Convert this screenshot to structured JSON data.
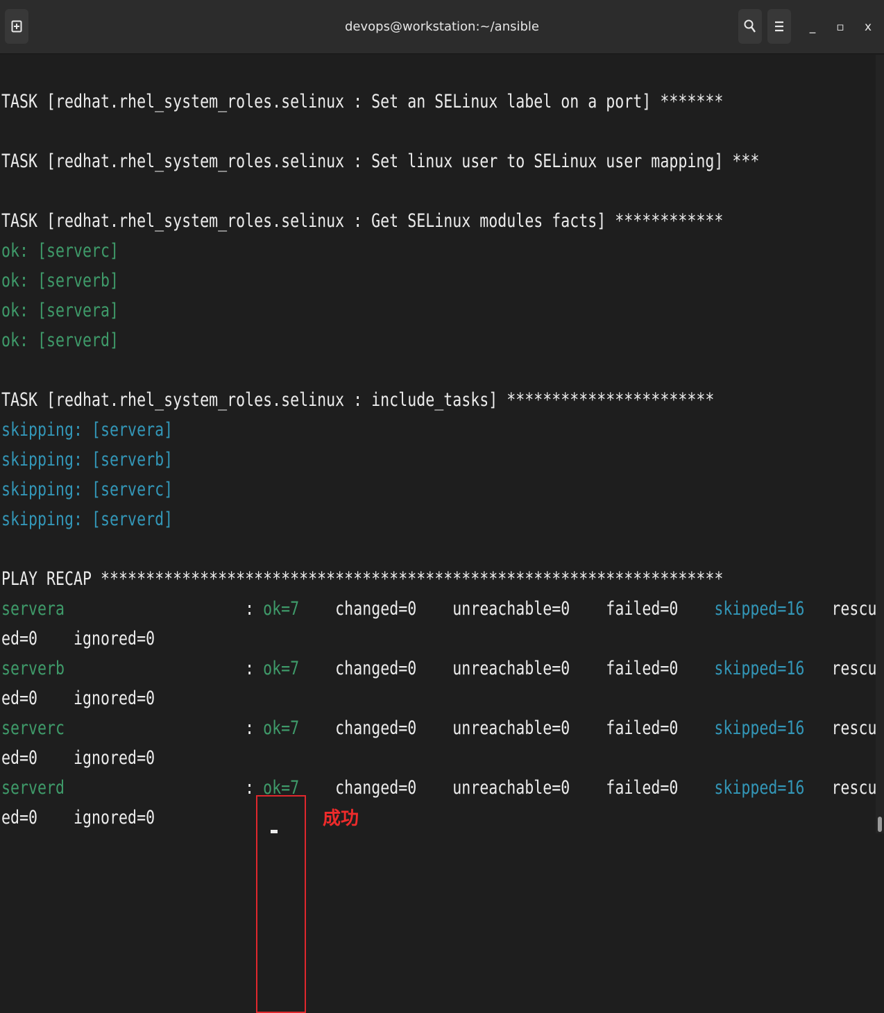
{
  "window": {
    "title": "devops@workstation:~/ansible",
    "new_tab_icon": "new-tab-icon",
    "search_icon": "search-icon",
    "menu_icon": "hamburger-menu-icon",
    "minimize_label": "_",
    "maximize_label": "▫",
    "close_label": "x"
  },
  "colors": {
    "background": "#1e1e1e",
    "ok_green": "#3f9b6a",
    "skipping_cyan": "#3397b8",
    "annotation_red": "#e0282d"
  },
  "terminal": {
    "lines": [
      {
        "segments": [
          {
            "text": "TASK [redhat.rhel_system_roles.selinux : Set an SELinux label on a port] *******",
            "color": "default"
          }
        ]
      },
      {
        "segments": [
          {
            "text": "",
            "color": "default"
          }
        ]
      },
      {
        "segments": [
          {
            "text": "TASK [redhat.rhel_system_roles.selinux : Set linux user to SELinux user mapping] ***",
            "color": "default"
          }
        ]
      },
      {
        "segments": [
          {
            "text": "",
            "color": "default"
          }
        ]
      },
      {
        "segments": [
          {
            "text": "TASK [redhat.rhel_system_roles.selinux : Get SELinux modules facts] ************",
            "color": "default"
          }
        ]
      },
      {
        "segments": [
          {
            "text": "ok: [serverc]",
            "color": "green"
          }
        ]
      },
      {
        "segments": [
          {
            "text": "ok: [serverb]",
            "color": "green"
          }
        ]
      },
      {
        "segments": [
          {
            "text": "ok: [servera]",
            "color": "green"
          }
        ]
      },
      {
        "segments": [
          {
            "text": "ok: [serverd]",
            "color": "green"
          }
        ]
      },
      {
        "segments": [
          {
            "text": "",
            "color": "default"
          }
        ]
      },
      {
        "segments": [
          {
            "text": "TASK [redhat.rhel_system_roles.selinux : include_tasks] ***********************",
            "color": "default"
          }
        ]
      },
      {
        "segments": [
          {
            "text": "skipping: [servera]",
            "color": "cyan"
          }
        ]
      },
      {
        "segments": [
          {
            "text": "skipping: [serverb]",
            "color": "cyan"
          }
        ]
      },
      {
        "segments": [
          {
            "text": "skipping: [serverc]",
            "color": "cyan"
          }
        ]
      },
      {
        "segments": [
          {
            "text": "skipping: [serverd]",
            "color": "cyan"
          }
        ]
      },
      {
        "segments": [
          {
            "text": "",
            "color": "default"
          }
        ]
      },
      {
        "segments": [
          {
            "text": "PLAY RECAP *********************************************************************",
            "color": "default"
          }
        ]
      },
      {
        "segments": [
          {
            "text": "servera",
            "color": "green"
          },
          {
            "text": "                    : ",
            "color": "default"
          },
          {
            "text": "ok=7",
            "color": "green"
          },
          {
            "text": "    changed=0    unreachable=0    failed=0    ",
            "color": "default"
          },
          {
            "text": "skipped=16",
            "color": "cyan"
          },
          {
            "text": "   rescu",
            "color": "default"
          }
        ]
      },
      {
        "segments": [
          {
            "text": "ed=0    ignored=0",
            "color": "default"
          }
        ]
      },
      {
        "segments": [
          {
            "text": "serverb",
            "color": "green"
          },
          {
            "text": "                    : ",
            "color": "default"
          },
          {
            "text": "ok=7",
            "color": "green"
          },
          {
            "text": "    changed=0    unreachable=0    failed=0    ",
            "color": "default"
          },
          {
            "text": "skipped=16",
            "color": "cyan"
          },
          {
            "text": "   rescu",
            "color": "default"
          }
        ]
      },
      {
        "segments": [
          {
            "text": "ed=0    ignored=0",
            "color": "default"
          }
        ]
      },
      {
        "segments": [
          {
            "text": "serverc",
            "color": "green"
          },
          {
            "text": "                    : ",
            "color": "default"
          },
          {
            "text": "ok=7",
            "color": "green"
          },
          {
            "text": "    changed=0    unreachable=0    failed=0    ",
            "color": "default"
          },
          {
            "text": "skipped=16",
            "color": "cyan"
          },
          {
            "text": "   rescu",
            "color": "default"
          }
        ]
      },
      {
        "segments": [
          {
            "text": "ed=0    ignored=0",
            "color": "default"
          }
        ]
      },
      {
        "segments": [
          {
            "text": "serverd",
            "color": "green"
          },
          {
            "text": "                    : ",
            "color": "default"
          },
          {
            "text": "ok=7",
            "color": "green"
          },
          {
            "text": "    changed=0    unreachable=0    failed=0    ",
            "color": "default"
          },
          {
            "text": "skipped=16",
            "color": "cyan"
          },
          {
            "text": "   rescu",
            "color": "default"
          }
        ]
      },
      {
        "segments": [
          {
            "text": "ed=0    ignored=0",
            "color": "default"
          }
        ]
      }
    ]
  },
  "annotation": {
    "label": "成功"
  }
}
